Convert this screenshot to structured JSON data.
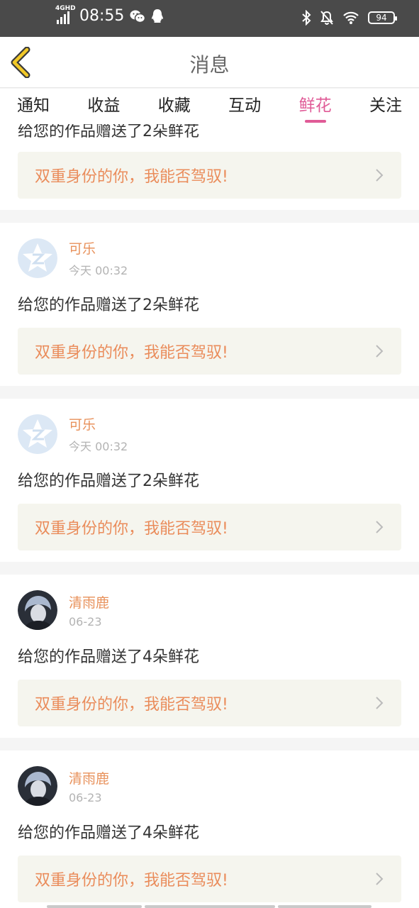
{
  "status_bar": {
    "network": "4GHD",
    "time": "08:55",
    "battery": "94",
    "left_icons": [
      "signal-icon",
      "wechat-icon",
      "qq-icon"
    ],
    "right_icons": [
      "bluetooth-icon",
      "mute-bell-icon",
      "wifi-icon",
      "battery-icon"
    ]
  },
  "header": {
    "title": "消息",
    "back_icon": "chevron-left-icon",
    "accent": "#f2c928"
  },
  "tabs": [
    {
      "label": "通知",
      "active": false
    },
    {
      "label": "收益",
      "active": false
    },
    {
      "label": "收藏",
      "active": false
    },
    {
      "label": "互动",
      "active": false
    },
    {
      "label": "鲜花",
      "active": true
    },
    {
      "label": "关注",
      "active": false
    }
  ],
  "colors": {
    "active_tab": "#e05b97",
    "username": "#e8915b",
    "work_title": "#ea8c5b",
    "work_box_bg": "#f5f5ee"
  },
  "messages": [
    {
      "partial": true,
      "message": "给您的作品赠送了2朵鲜花",
      "work_title": "双重身份的你，我能否驾驭!"
    },
    {
      "avatar": "qzone-avatar",
      "name": "可乐",
      "time": "今天 00:32",
      "message": "给您的作品赠送了2朵鲜花",
      "work_title": "双重身份的你，我能否驾驭!"
    },
    {
      "avatar": "qzone-avatar",
      "name": "可乐",
      "time": "今天 00:32",
      "message": "给您的作品赠送了2朵鲜花",
      "work_title": "双重身份的你，我能否驾驭!"
    },
    {
      "avatar": "photo-avatar",
      "name": "清雨鹿",
      "time": "06-23",
      "message": "给您的作品赠送了4朵鲜花",
      "work_title": "双重身份的你，我能否驾驭!"
    },
    {
      "avatar": "photo-avatar",
      "name": "清雨鹿",
      "time": "06-23",
      "message": "给您的作品赠送了4朵鲜花",
      "work_title": "双重身份的你，我能否驾驭!"
    }
  ]
}
